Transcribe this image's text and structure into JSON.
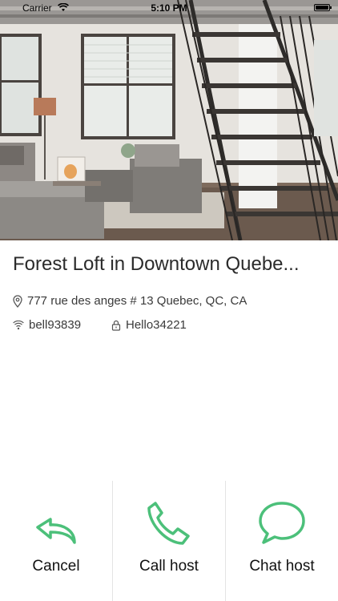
{
  "status_bar": {
    "carrier": "Carrier",
    "time": "5:10 PM"
  },
  "listing": {
    "title": "Forest Loft in Downtown Quebe...",
    "address": "777 rue des anges # 13 Quebec, QC, CA",
    "wifi_name": "bell93839",
    "wifi_password": "Hello34221"
  },
  "actions": {
    "cancel_label": "Cancel",
    "call_label": "Call host",
    "chat_label": "Chat host"
  },
  "colors": {
    "accent": "#4cc07a",
    "text": "#2b2b2b"
  },
  "icons": {
    "address": "location-pin-icon",
    "wifi": "wifi-icon",
    "password": "lock-icon",
    "cancel": "undo-arrow-icon",
    "call": "phone-icon",
    "chat": "chat-bubble-icon"
  }
}
